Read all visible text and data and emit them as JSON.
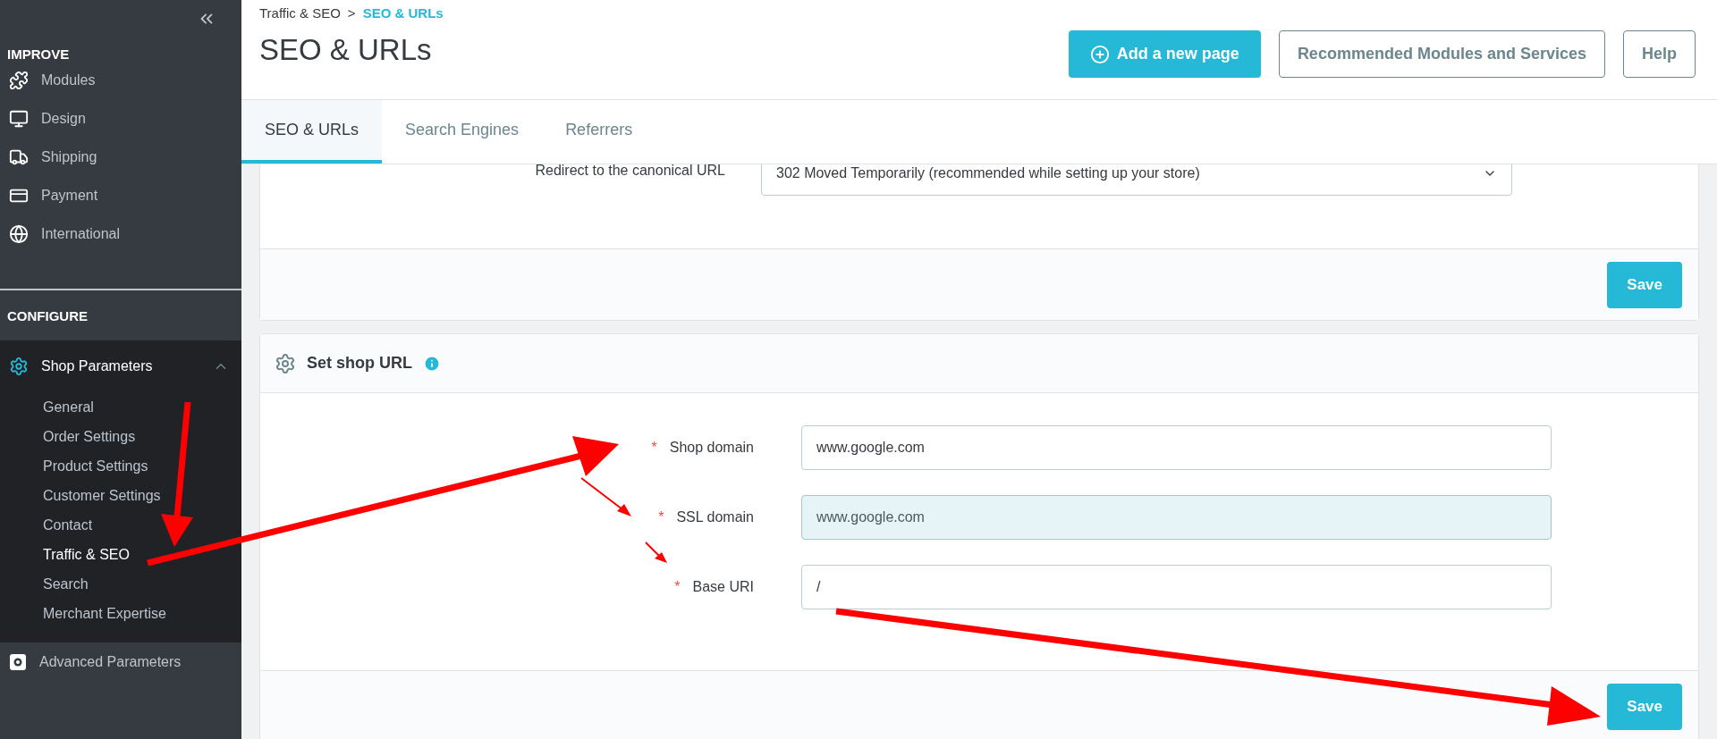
{
  "sidebar": {
    "sections": [
      {
        "title": "IMPROVE",
        "items": [
          {
            "label": "Modules",
            "selected": false,
            "expanded": false
          },
          {
            "label": "Design",
            "selected": false,
            "expanded": false
          },
          {
            "label": "Shipping",
            "selected": false,
            "expanded": false
          },
          {
            "label": "Payment",
            "selected": false,
            "expanded": false
          },
          {
            "label": "International",
            "selected": false,
            "expanded": false
          }
        ]
      },
      {
        "title": "CONFIGURE",
        "items": [
          {
            "label": "Shop Parameters",
            "selected": true,
            "expanded": true,
            "children": [
              {
                "label": "General",
                "selected": false
              },
              {
                "label": "Order Settings",
                "selected": false
              },
              {
                "label": "Product Settings",
                "selected": false
              },
              {
                "label": "Customer Settings",
                "selected": false
              },
              {
                "label": "Contact",
                "selected": false
              },
              {
                "label": "Traffic & SEO",
                "selected": true
              },
              {
                "label": "Search",
                "selected": false
              },
              {
                "label": "Merchant Expertise",
                "selected": false
              }
            ]
          },
          {
            "label": "Advanced Parameters",
            "selected": false,
            "expanded": false
          }
        ]
      }
    ]
  },
  "breadcrumb": {
    "parent": "Traffic & SEO",
    "separator": ">",
    "current": "SEO & URLs"
  },
  "page_title": "SEO & URLs",
  "header_buttons": [
    {
      "label": "Add a new page",
      "kind": "primary"
    },
    {
      "label": "Recommended Modules and Services",
      "kind": "outline"
    },
    {
      "label": "Help",
      "kind": "outline"
    }
  ],
  "tabs": [
    {
      "label": "SEO & URLs",
      "selected": true
    },
    {
      "label": "Search Engines",
      "selected": false
    },
    {
      "label": "Referrers",
      "selected": false
    }
  ],
  "top_card": {
    "field_label": "Redirect to the canonical URL",
    "select_value": "302 Moved Temporarily (recommended while setting up your store)",
    "save_label": "Save"
  },
  "shop_url_card": {
    "title": "Set shop URL",
    "fields": [
      {
        "required_mark": "*",
        "label": "Shop domain",
        "value": "www.google.com",
        "disabled": false
      },
      {
        "required_mark": "*",
        "label": "SSL domain",
        "value": "www.google.com",
        "disabled": true
      },
      {
        "required_mark": "*",
        "label": "Base URI",
        "value": "/",
        "disabled": false
      }
    ],
    "save_label": "Save"
  }
}
